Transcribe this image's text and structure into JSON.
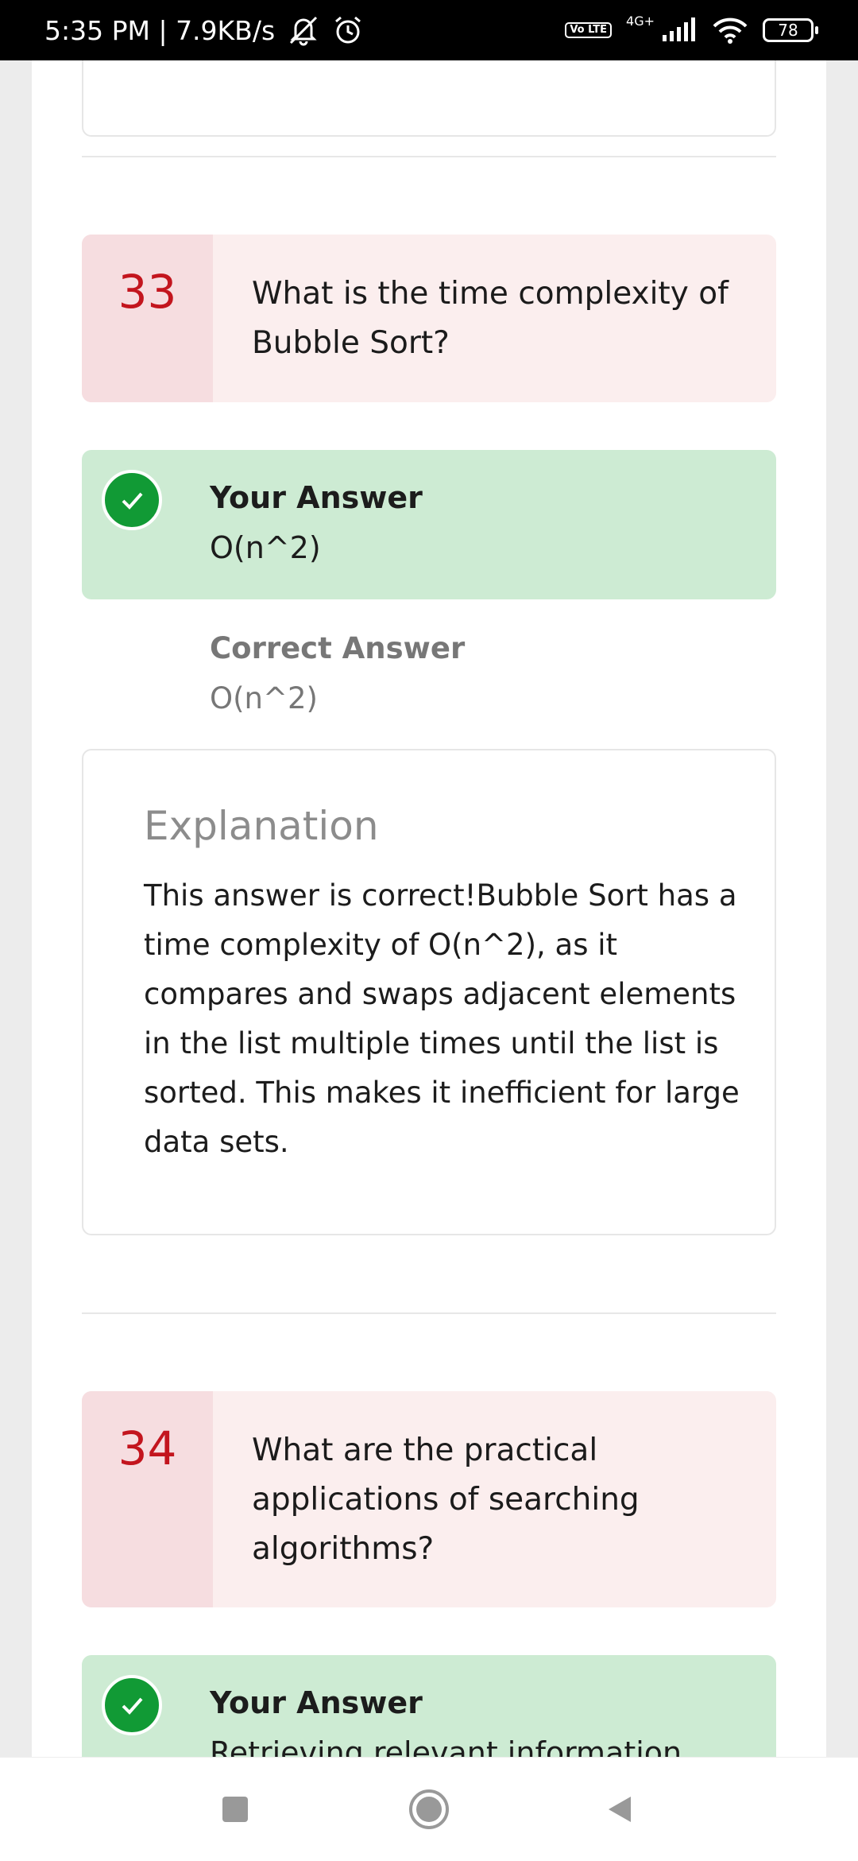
{
  "status_bar": {
    "time_speed": "5:35 PM | 7.9KB/s",
    "volte": "Vo LTE",
    "network": "4G+",
    "battery": "78"
  },
  "questions": [
    {
      "number": "33",
      "text": "What is the time complexity of Bubble Sort?",
      "your_answer_label": "Your Answer",
      "your_answer": "O(n^2)",
      "correct_answer_label": "Correct Answer",
      "correct_answer": "O(n^2)",
      "explanation_title": "Explanation",
      "explanation": "This answer is correct!Bubble Sort has a time complexity of O(n^2), as it compares and swaps adjacent elements in the list multiple times until the list is sorted. This makes it inefficient for large data sets."
    },
    {
      "number": "34",
      "text": "What are the practical applications of searching algorithms?",
      "your_answer_label": "Your Answer",
      "your_answer": "Retrieving relevant information"
    }
  ],
  "colors": {
    "question_number": "#c3151e",
    "question_bg": "#fbeeee",
    "answer_bg": "#cdebd3",
    "check": "#119a35"
  },
  "icons": {
    "correct": "check-circle-icon",
    "nav_recent": "square-icon",
    "nav_home": "circle-icon",
    "nav_back": "triangle-back-icon"
  }
}
